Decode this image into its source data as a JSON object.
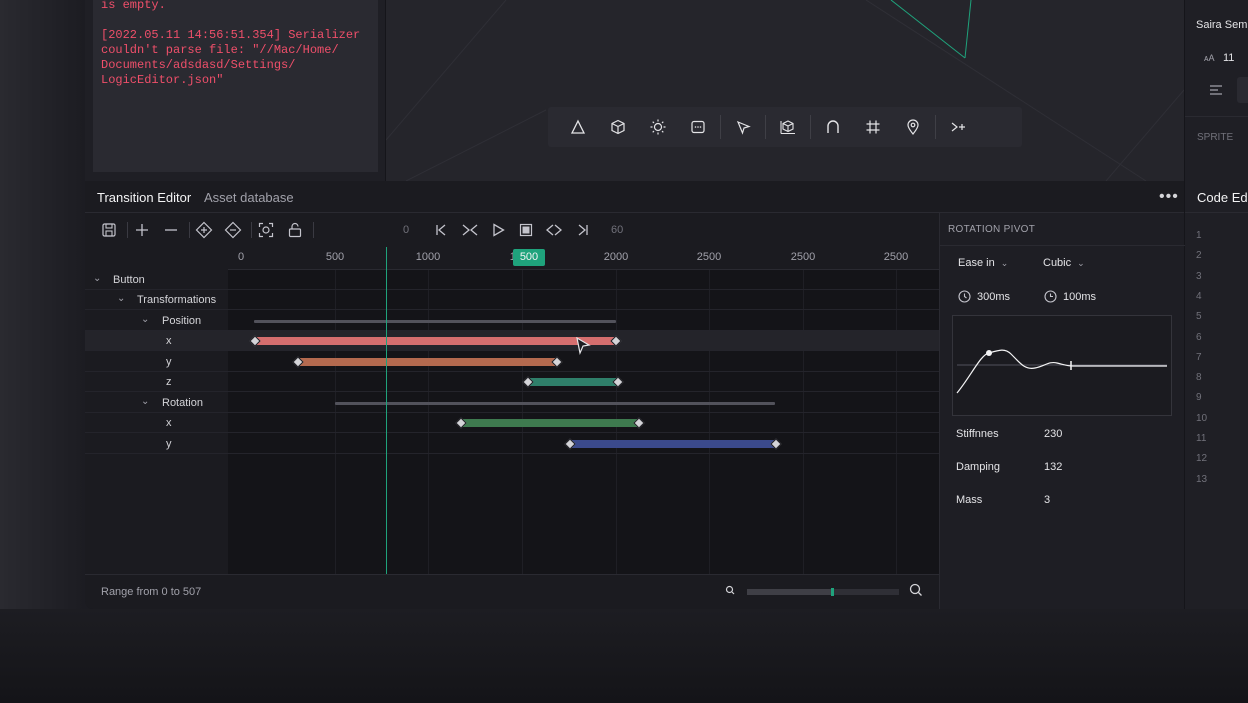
{
  "console": {
    "line1": "is empty.",
    "line2": "[2022.05.11 14:56:51.354] Serializer couldn't parse file: \"//Mac/Home/ Documents/adsdasd/Settings/ LogicEditor.json\""
  },
  "toolbar3d": {
    "icons": [
      "triangle-icon",
      "cube-icon",
      "sun-icon",
      "rectangle-icon",
      "cursor-icon",
      "box-icon",
      "magnet-icon",
      "grid-icon",
      "pin-icon",
      "branch-icon"
    ]
  },
  "right_panel": {
    "font_name": "Saira Semi",
    "font_size": "11",
    "section": "SPRITE",
    "code_title": "Code Edit",
    "line_numbers": [
      "1",
      "2",
      "3",
      "4",
      "5",
      "6",
      "7",
      "8",
      "9",
      "10",
      "11",
      "12",
      "13"
    ]
  },
  "tabs": {
    "active": "Transition Editor",
    "inactive": "Asset database"
  },
  "controls": {
    "frame_start": "0",
    "frame_end": "60"
  },
  "ruler": {
    "labels": [
      "0",
      "500",
      "1000",
      "1500",
      "2000",
      "2500",
      "2500",
      "2500"
    ],
    "playhead": "500"
  },
  "tree": {
    "button": "Button",
    "transformations": "Transformations",
    "position": "Position",
    "pos_x": "x",
    "pos_y": "y",
    "pos_z": "z",
    "rotation": "Rotation",
    "rot_x": "x",
    "rot_y": "y"
  },
  "colors": {
    "accent": "#1fa37c",
    "pos_x": "#d56e6e",
    "pos_y": "#b46a4f",
    "pos_z": "#2f7f6a",
    "rot_x": "#3e7a4f",
    "rot_y": "#3b4a8c",
    "console_error": "#ef4f6a"
  },
  "status": {
    "range": "Range from 0 to 507",
    "zoom_level": 0.55
  },
  "pivot": {
    "title": "ROTATION PIVOT",
    "ease": "Ease in",
    "curve": "Cubic",
    "duration1": "300ms",
    "duration2": "100ms",
    "stiffness_label": "Stiffnnes",
    "stiffness_value": "230",
    "damping_label": "Damping",
    "damping_value": "132",
    "mass_label": "Mass",
    "mass_value": "3"
  }
}
